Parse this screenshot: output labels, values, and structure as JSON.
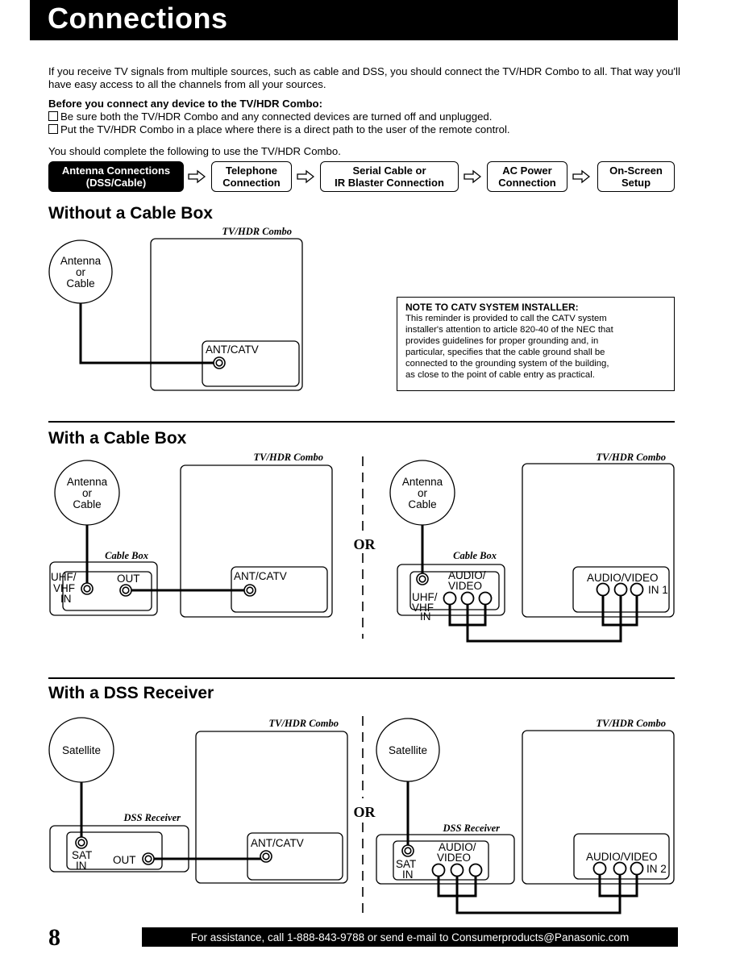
{
  "header": {
    "title": "Connections"
  },
  "intro": {
    "text": "If you receive TV signals from multiple sources, such as cable and DSS, you should connect the TV/HDR Combo to all. That way you'll have easy access to all the channels from all your sources.",
    "prereq_heading": "Before you connect any device to the TV/HDR Combo:",
    "prereq_items": [
      "Be sure both the TV/HDR Combo and any connected devices are turned off and unplugged.",
      "Put the TV/HDR Combo in a place where there is a direct path to the user of the remote control."
    ],
    "complete_text": "You should complete the following to use the TV/HDR Combo."
  },
  "steps": [
    {
      "line1": "Antenna Connections",
      "line2": "(DSS/Cable)",
      "active": true
    },
    {
      "line1": "Telephone",
      "line2": "Connection",
      "active": false
    },
    {
      "line1": "Serial Cable or",
      "line2": "IR Blaster Connection",
      "active": false
    },
    {
      "line1": "AC Power",
      "line2": "Connection",
      "active": false
    },
    {
      "line1": "On-Screen",
      "line2": "Setup",
      "active": false
    }
  ],
  "sections": {
    "without_cable_box": {
      "heading": "Without a Cable Box",
      "source": [
        "Antenna",
        "or",
        "Cable"
      ],
      "tv_label": "TV/HDR Combo",
      "tv_port": "ANT/CATV"
    },
    "note": {
      "heading": "NOTE TO CATV SYSTEM INSTALLER:",
      "lines": [
        "This reminder is provided to call the CATV system",
        "installer's attention to article 820-40 of the NEC that",
        "provides guidelines for proper grounding and, in",
        "particular, specifies that the cable ground shall be",
        "connected to the grounding system of the building,",
        "as close to the point of cable entry as practical."
      ]
    },
    "with_cable_box": {
      "heading": "With a Cable Box",
      "or_label": "OR",
      "left": {
        "source": [
          "Antenna",
          "or",
          "Cable"
        ],
        "device_label": "Cable Box",
        "device_in": [
          "UHF/",
          "VHF",
          "IN"
        ],
        "device_out": "OUT",
        "tv_label": "TV/HDR Combo",
        "tv_port": "ANT/CATV"
      },
      "right": {
        "source": [
          "Antenna",
          "or",
          "Cable"
        ],
        "device_label": "Cable Box",
        "device_in": [
          "UHF/",
          "VHF",
          "IN"
        ],
        "device_av": [
          "AUDIO/",
          "VIDEO"
        ],
        "tv_label": "TV/HDR Combo",
        "tv_port": "AUDIO/VIDEO",
        "tv_input": "IN 1"
      }
    },
    "with_dss": {
      "heading": "With a DSS Receiver",
      "or_label": "OR",
      "left": {
        "source": "Satellite",
        "device_label": "DSS Receiver",
        "device_in": [
          "SAT",
          "IN"
        ],
        "device_out": "OUT",
        "tv_label": "TV/HDR Combo",
        "tv_port": "ANT/CATV"
      },
      "right": {
        "source": "Satellite",
        "device_label": "DSS Receiver",
        "device_in": [
          "SAT",
          "IN"
        ],
        "device_av": [
          "AUDIO/",
          "VIDEO"
        ],
        "tv_label": "TV/HDR Combo",
        "tv_port": "AUDIO/VIDEO",
        "tv_input": "IN 2"
      }
    }
  },
  "footer": {
    "page_number": "8",
    "assistance": "For assistance, call 1-888-843-9788 or send e-mail to Consumerproducts@Panasonic.com"
  }
}
